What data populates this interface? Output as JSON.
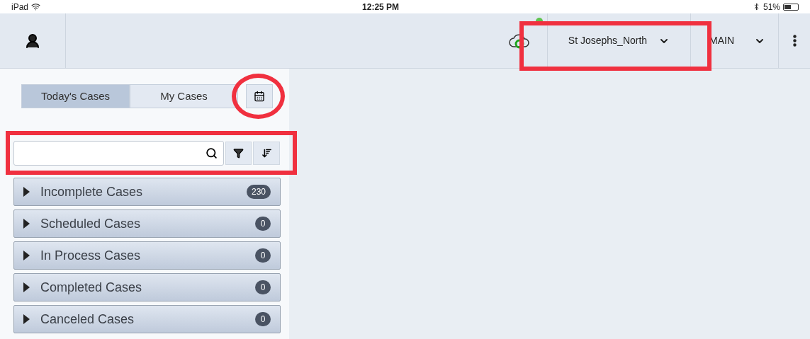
{
  "status_bar": {
    "device": "iPad",
    "time": "12:25 PM",
    "battery": "51%"
  },
  "header": {
    "location": "St Josephs_North",
    "site": "MAIN",
    "synced": true
  },
  "tabs": [
    {
      "label": "Today's Cases",
      "selected": true
    },
    {
      "label": "My Cases",
      "selected": false
    }
  ],
  "sections": [
    {
      "label": "Incomplete Cases",
      "count": "230",
      "expanded": false
    },
    {
      "label": "Scheduled Cases",
      "count": "0",
      "expanded": false
    },
    {
      "label": "In Process Cases",
      "count": "0",
      "expanded": false
    },
    {
      "label": "Completed Cases",
      "count": "0",
      "expanded": false
    },
    {
      "label": "Canceled Cases",
      "count": "0",
      "expanded": false
    }
  ],
  "annotations": [
    {
      "kind": "rect"
    },
    {
      "kind": "circle"
    },
    {
      "kind": "rect"
    }
  ]
}
